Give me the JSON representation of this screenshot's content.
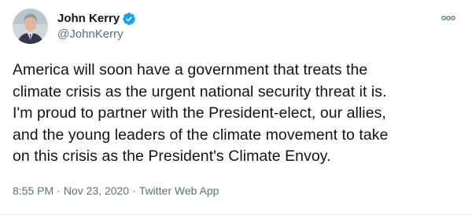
{
  "tweet": {
    "author": {
      "display_name": "John Kerry",
      "handle": "@JohnKerry",
      "verified": true,
      "avatar_icon": "profile-photo"
    },
    "text": "America will soon have a government that treats the\nclimate crisis as the urgent national security threat it is.\nI'm proud to partner with the President-elect, our allies,\nand the young leaders of the climate movement to take\non this crisis as the President's Climate Envoy.",
    "time": "8:55 PM",
    "date": "Nov 23, 2020",
    "separator": "·",
    "source": "Twitter Web App"
  },
  "colors": {
    "accent": "#1da1f2",
    "text": "#0f1419",
    "secondary": "#5b7083"
  },
  "icons": {
    "verified": "verified-badge-icon",
    "more": "more-options-icon"
  }
}
